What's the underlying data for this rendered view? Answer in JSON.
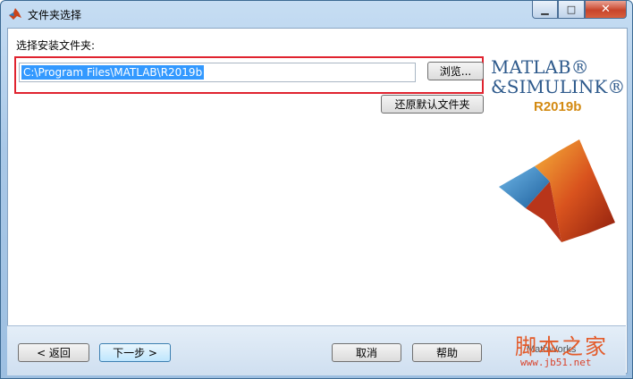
{
  "window": {
    "title": "文件夹选择",
    "minimize_icon": "minimize-icon",
    "maximize_icon": "maximize-icon",
    "close_icon": "close-icon"
  },
  "main": {
    "prompt": "选择安装文件夹:",
    "path_value": "C:\\Program Files\\MATLAB\\R2019b",
    "browse_label": "浏览...",
    "restore_default_label": "还原默认文件夹",
    "highlight_color": "#e0232f"
  },
  "branding": {
    "line1": "MATLAB®",
    "line2": "&SIMULINK®",
    "release": "R2019b",
    "mathworks": "MathWorks"
  },
  "footer": {
    "back_label": "< 返回",
    "next_label": "下一步 >",
    "cancel_label": "取消",
    "help_label": "帮助"
  },
  "watermark": {
    "site_name": "脚本之家",
    "url": "www.jb51.net"
  }
}
